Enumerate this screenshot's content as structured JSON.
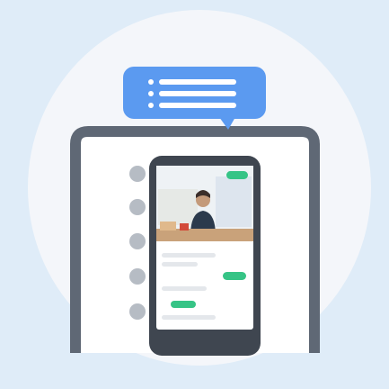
{
  "illustration": {
    "subject": "chat-bubble-over-laptop-with-phone-video-call",
    "colors": {
      "background": "#dfecf8",
      "circle": "#f4f6fa",
      "bubble": "#5b9af0",
      "frame": "#5f6875",
      "phone_body": "#3f4650",
      "accent": "#36c486",
      "dot": "#b6bcc4"
    }
  }
}
